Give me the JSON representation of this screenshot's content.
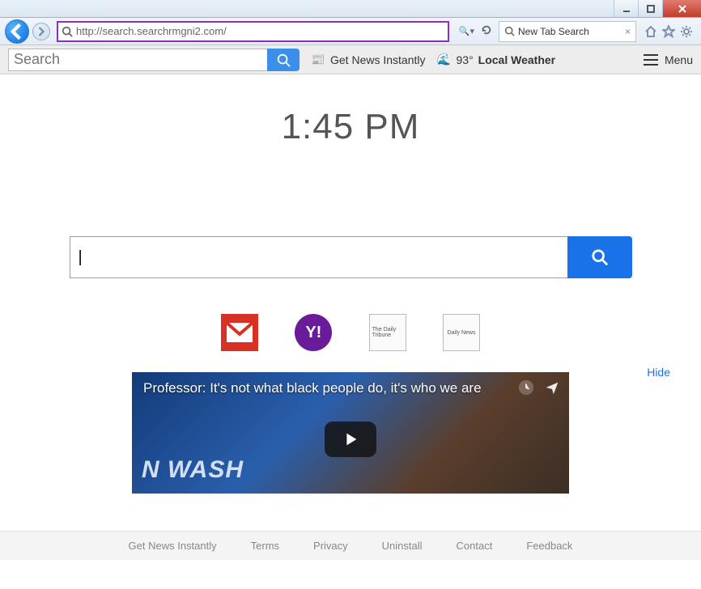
{
  "window": {
    "address_url": "http://search.searchrmgni2.com/",
    "tab_title": "New Tab Search"
  },
  "toolbar": {
    "search_placeholder": "Search",
    "news_label": "Get News Instantly",
    "weather_temp": "93°",
    "weather_label": "Local Weather",
    "menu_label": "Menu"
  },
  "page": {
    "clock": "1:45 PM",
    "main_search_value": "|",
    "hide_label": "Hide",
    "shortcuts": {
      "gmail": "gmail-icon",
      "yahoo": "Y!",
      "news1": "The Daily Tribune",
      "news2": "Daily News"
    },
    "video": {
      "title": "Professor: It's not what black people do, it's who we are",
      "channel_watermark": "N WASH"
    }
  },
  "footer": {
    "links": [
      "Get News Instantly",
      "Terms",
      "Privacy",
      "Uninstall",
      "Contact",
      "Feedback"
    ]
  }
}
